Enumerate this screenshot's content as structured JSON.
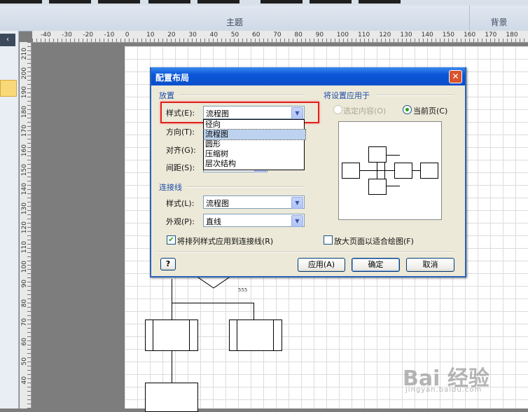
{
  "ribbon": {
    "group_theme": "主题",
    "group_background": "背景"
  },
  "left_panel": {
    "collapse_arrow": "‹"
  },
  "rulers": {
    "horizontal": [
      "-40",
      "-30",
      "-20",
      "-10",
      "0",
      "10",
      "20",
      "30",
      "40",
      "50",
      "60",
      "70",
      "80",
      "90",
      "100",
      "110",
      "120",
      "130",
      "140",
      "150",
      "160",
      "170",
      "180"
    ],
    "vertical": [
      "210",
      "200",
      "190",
      "180",
      "170",
      "160",
      "150",
      "140",
      "130",
      "120",
      "110",
      "100",
      "90",
      "80",
      "70",
      "60",
      "50",
      "40"
    ]
  },
  "diagram": {
    "shape_label": "555"
  },
  "dialog": {
    "title": "配置布局",
    "close_icon": "✕",
    "placement_section": "放置",
    "style_label": "样式(E):",
    "style_value": "流程图",
    "direction_label": "方向(T):",
    "align_label": "对齐(G):",
    "spacing_label": "间距(S):",
    "style_options": [
      "径向",
      "流程图",
      "圆形",
      "压缩树",
      "层次结构"
    ],
    "selected_option": "流程图",
    "connectors_section": "连接线",
    "conn_style_label": "样式(L):",
    "conn_style_value": "流程图",
    "appearance_label": "外观(P):",
    "appearance_value": "直线",
    "apply_routing_checkbox": "将排列样式应用到连接线(R)",
    "apply_routing_checked": true,
    "apply_to_section": "将设置应用于",
    "selection_radio": "选定内容(O)",
    "current_page_radio": "当前页(C)",
    "current_page_selected": true,
    "enlarge_checkbox": "放大页面以适合绘图(F)",
    "enlarge_checked": false,
    "help_icon": "?",
    "apply_button": "应用(A)",
    "ok_button": "确定",
    "cancel_button": "取消"
  },
  "watermark": {
    "main": "Bai 经验",
    "sub": "jingyan.baidu.com"
  },
  "colors": {
    "title_bar": "#0a56d8",
    "highlight_box": "#e0201c",
    "dialog_bg": "#ece9d8"
  }
}
